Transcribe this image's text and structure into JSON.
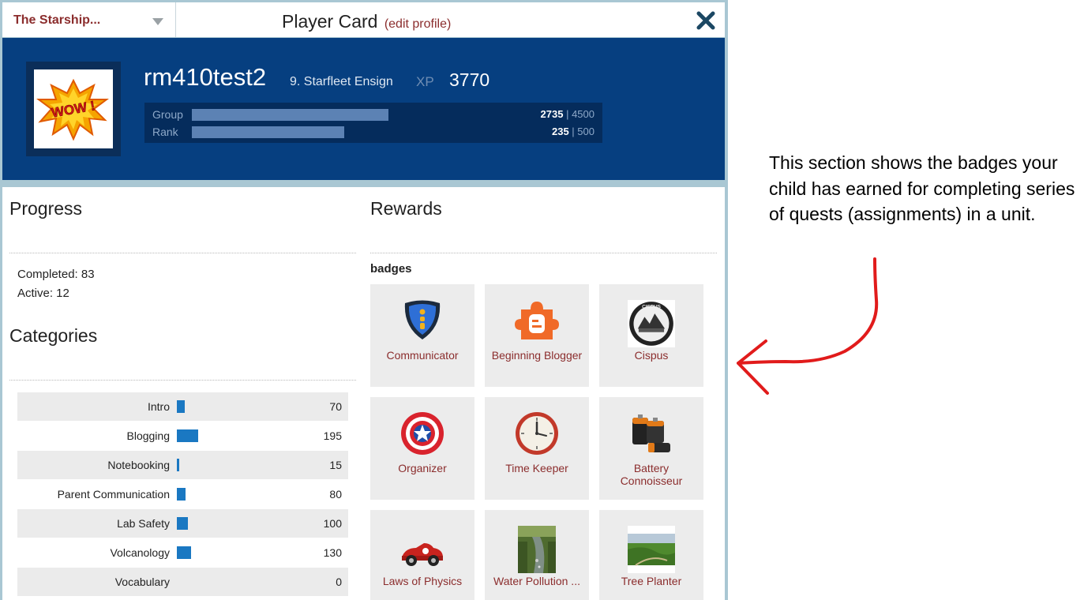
{
  "header": {
    "ship_name": "The Starship...",
    "title": "Player Card",
    "edit_link": "(edit profile)"
  },
  "profile": {
    "username": "rm410test2",
    "rank_title": "9. Starfleet Ensign",
    "xp_label": "XP",
    "xp_value": "3770",
    "avatar_text": "WOW !",
    "group": {
      "label": "Group",
      "current": "2735",
      "sep": " | ",
      "max": "4500",
      "progress": 0.608
    },
    "rank": {
      "label": "Rank",
      "current": "235",
      "sep": " | ",
      "max": "500",
      "progress": 0.47
    }
  },
  "progress": {
    "heading": "Progress",
    "completed": "Completed: 83",
    "active": "Active: 12"
  },
  "categories": {
    "heading": "Categories",
    "max_value": 195,
    "items": [
      {
        "name": "Intro",
        "value": "70"
      },
      {
        "name": "Blogging",
        "value": "195"
      },
      {
        "name": "Notebooking",
        "value": "15"
      },
      {
        "name": "Parent Communication",
        "value": "80"
      },
      {
        "name": "Lab Safety",
        "value": "100"
      },
      {
        "name": "Volcanology",
        "value": "130"
      },
      {
        "name": "Vocabulary",
        "value": "0"
      }
    ]
  },
  "rewards": {
    "heading": "Rewards",
    "badges_label": "badges",
    "badges": [
      {
        "label": "Communicator",
        "icon": "shield-icon"
      },
      {
        "label": "Beginning Blogger",
        "icon": "blogger-puzzle-icon"
      },
      {
        "label": "Cispus",
        "icon": "cispus-seal-icon",
        "seal_text": "CISPUS"
      },
      {
        "label": "Organizer",
        "icon": "star-shield-icon"
      },
      {
        "label": "Time Keeper",
        "icon": "clock-icon"
      },
      {
        "label": "Battery Connoisseur",
        "icon": "battery-icon"
      },
      {
        "label": "Laws of Physics",
        "icon": "race-car-icon"
      },
      {
        "label": "Water Pollution ...",
        "icon": "stream-photo-icon"
      },
      {
        "label": "Tree Planter",
        "icon": "landscape-photo-icon"
      }
    ]
  },
  "annotation": {
    "text": "This section shows the badges your child has earned for completing series of quests (assignments) in a unit.",
    "color": "#e11b1b"
  },
  "colors": {
    "banner": "#063f80",
    "accent_text": "#8b2d2d",
    "category_bar": "#1a78c2"
  }
}
